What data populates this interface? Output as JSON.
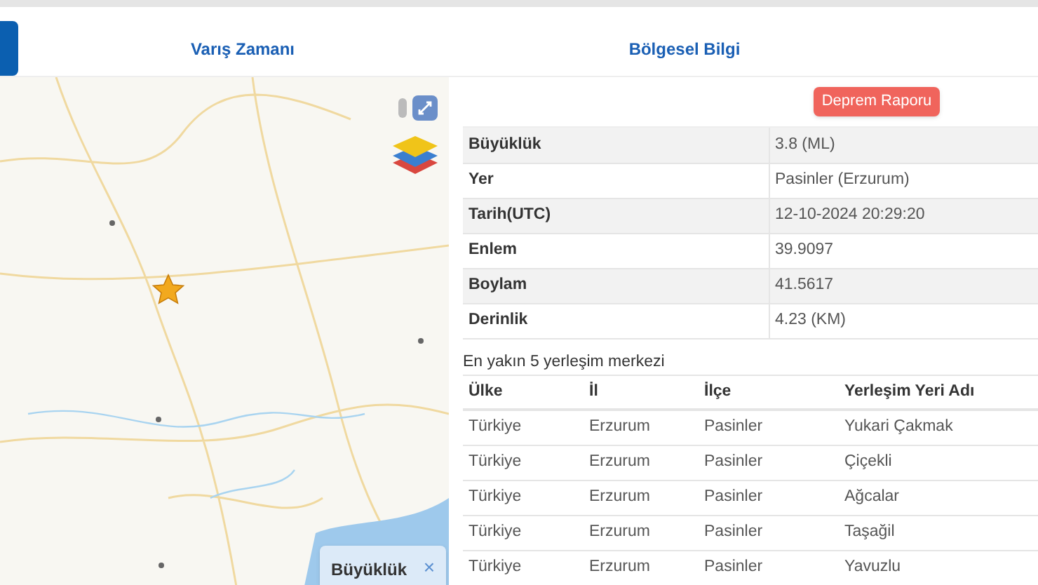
{
  "tabs": [
    {
      "selected": true
    },
    {
      "label": "Varış Zamanı",
      "selected": false
    },
    {
      "label": "Bölgesel Bilgi",
      "selected": false
    }
  ],
  "map": {
    "popup": {
      "title": "Büyüklük",
      "close": "×"
    }
  },
  "report_button": "Deprem Raporu",
  "info": [
    {
      "label": "Büyüklük",
      "value": "3.8 (ML)"
    },
    {
      "label": "Yer",
      "value": "Pasinler (Erzurum)"
    },
    {
      "label": "Tarih(UTC)",
      "value": "12-10-2024 20:29:20"
    },
    {
      "label": "Enlem",
      "value": "39.9097"
    },
    {
      "label": "Boylam",
      "value": "41.5617"
    },
    {
      "label": "Derinlik",
      "value": "4.23 (KM)"
    }
  ],
  "places_title": "En yakın 5 yerleşim merkezi",
  "places": {
    "columns": [
      "Ülke",
      "İl",
      "İlçe",
      "Yerleşim Yeri Adı"
    ],
    "rows": [
      [
        "Türkiye",
        "Erzurum",
        "Pasinler",
        "Yukari Çakmak"
      ],
      [
        "Türkiye",
        "Erzurum",
        "Pasinler",
        "Çiçekli"
      ],
      [
        "Türkiye",
        "Erzurum",
        "Pasinler",
        "Ağcalar"
      ],
      [
        "Türkiye",
        "Erzurum",
        "Pasinler",
        "Taşağil"
      ],
      [
        "Türkiye",
        "Erzurum",
        "Pasinler",
        "Yavuzlu"
      ]
    ]
  }
}
